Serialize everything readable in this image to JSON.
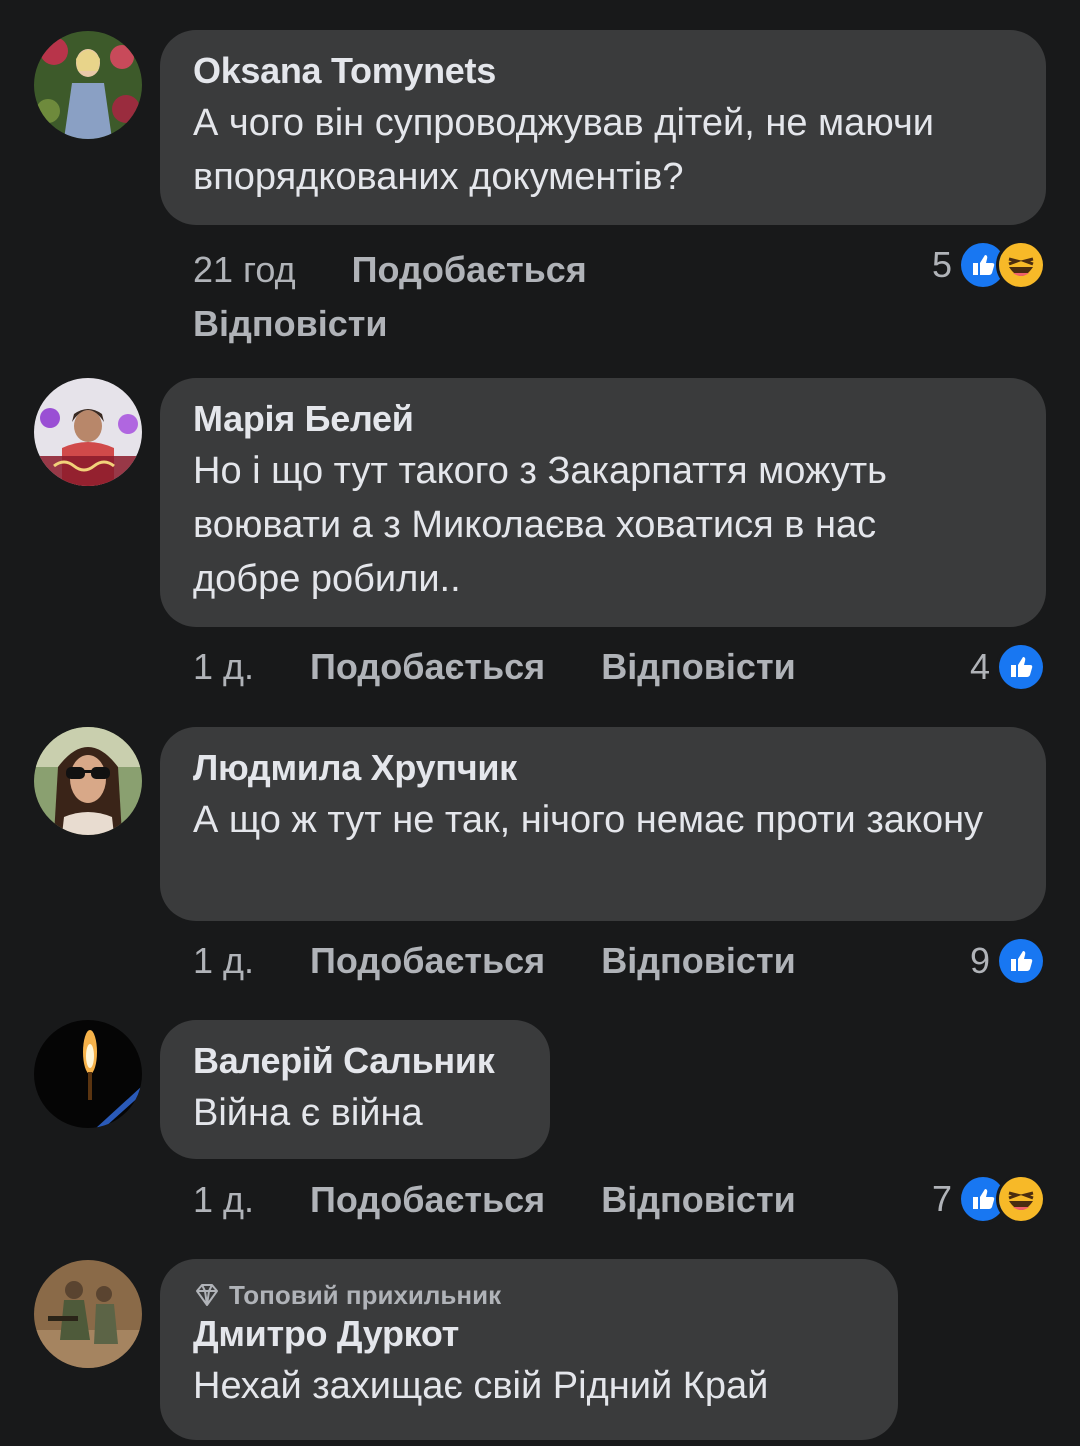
{
  "comments": [
    {
      "author": "Oksana Tomynets",
      "text": "А чого він супроводжував дітей, не маючи впорядкованих документів?",
      "time": "21 год",
      "like_label": "Подобається",
      "reply_label": "Відповісти",
      "reaction_count": "5",
      "reactions": [
        "like-icon",
        "haha-icon"
      ]
    },
    {
      "author": "Марія Белей",
      "text": "Но і що тут такого з Закарпаття можуть воювати а з Миколаєва ховатися в нас добре робили..",
      "time": "1 д.",
      "like_label": "Подобається",
      "reply_label": "Відповісти",
      "reaction_count": "4",
      "reactions": [
        "like-icon"
      ]
    },
    {
      "author": "Людмила Хрупчик",
      "text": "А що ж тут не так, нічого немає проти закону",
      "time": "1 д.",
      "like_label": "Подобається",
      "reply_label": "Відповісти",
      "reaction_count": "9",
      "reactions": [
        "like-icon"
      ]
    },
    {
      "author": "Валерій Сальник",
      "text": "Війна є війна",
      "time": "1 д.",
      "like_label": "Подобається",
      "reply_label": "Відповісти",
      "reaction_count": "7",
      "reactions": [
        "like-icon",
        "haha-icon"
      ]
    },
    {
      "badge": "Топовий прихильник",
      "author": "Дмитро Дуркот",
      "text": "Нехай захищає свій Рідний Край"
    }
  ],
  "colors": {
    "background": "#18191a",
    "bubble": "#3a3b3c",
    "text": "#e4e6eb",
    "secondary_text": "#b0b3b8",
    "like_blue": "#1877f2",
    "haha_yellow": "#f7b928"
  }
}
